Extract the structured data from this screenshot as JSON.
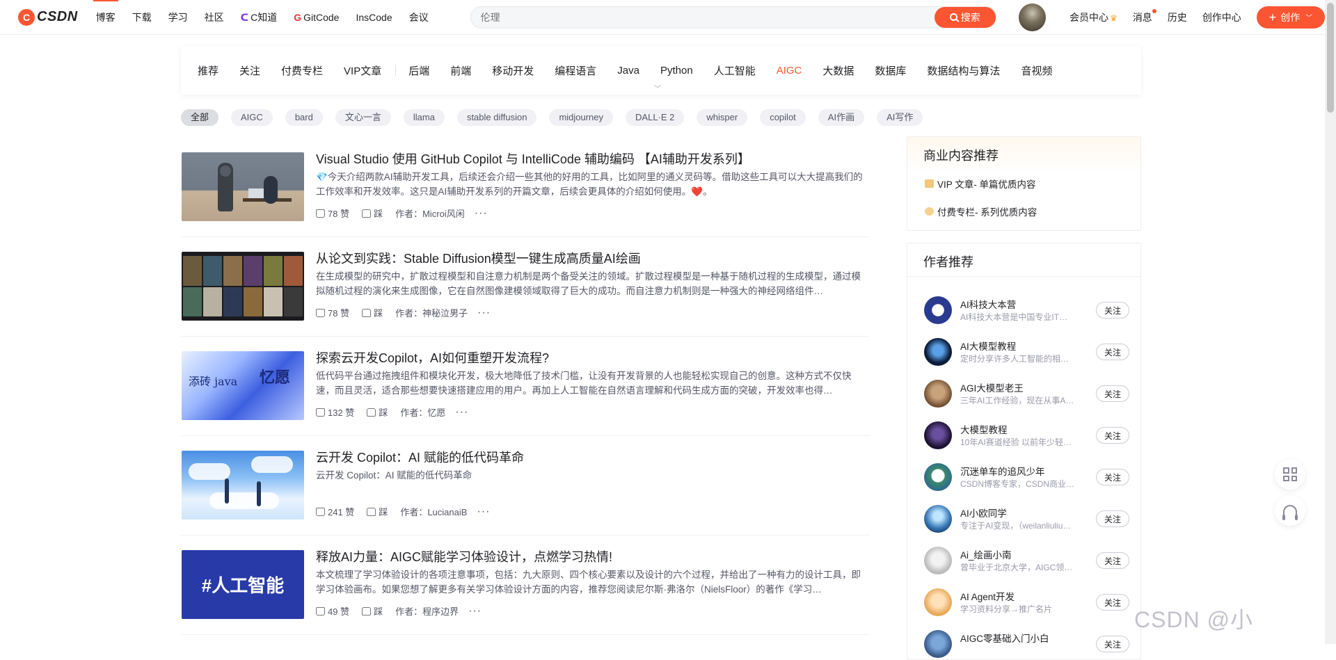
{
  "topnav": {
    "logo_text": "CSDN",
    "items": [
      "博客",
      "下载",
      "学习",
      "社区",
      "C知道",
      "GitCode",
      "InsCode",
      "会议"
    ],
    "active_index": 0,
    "search_placeholder": "伦理",
    "search_button": "搜索",
    "links": [
      "会员中心",
      "消息",
      "历史",
      "创作中心"
    ],
    "create_button": "创作"
  },
  "categories": [
    "推荐",
    "关注",
    "付费专栏",
    "VIP文章",
    "后端",
    "前端",
    "移动开发",
    "编程语言",
    "Java",
    "Python",
    "人工智能",
    "AIGC",
    "大数据",
    "数据库",
    "数据结构与算法",
    "音视频"
  ],
  "category_highlight": "AIGC",
  "tags": [
    "全部",
    "AIGC",
    "bard",
    "文心一言",
    "llama",
    "stable diffusion",
    "midjourney",
    "DALL·E 2",
    "whisper",
    "copilot",
    "AI作画",
    "AI写作"
  ],
  "articles": [
    {
      "title": "Visual Studio 使用 GitHub Copilot 与 IntelliCode 辅助编码 【AI辅助开发系列】",
      "desc": "💎今天介绍两款AI辅助开发工具，后续还会介绍一些其他的好用的工具，比如阿里的通义灵码等。借助这些工具可以大大提高我们的工作效率和开发效率。这只是AI辅助开发系列的开篇文章，后续会更具体的介绍如何使用。❤️。",
      "likes": "78 赞",
      "dislike": "踩",
      "author": "作者：Microi风闲"
    },
    {
      "title": "从论文到实践：Stable Diffusion模型一键生成高质量AI绘画",
      "desc": "在生成模型的研究中，扩散过程模型和自注意力机制是两个备受关注的领域。扩散过程模型是一种基于随机过程的生成模型，通过模拟随机过程的演化来生成图像，它在自然图像建模领域取得了巨大的成功。而自注意力机制则是一种强大的神经网络组件…",
      "likes": "78 赞",
      "dislike": "踩",
      "author": "作者：神秘泣男子"
    },
    {
      "title": "探索云开发Copilot，AI如何重塑开发流程?",
      "desc": "低代码平台通过拖拽组件和模块化开发，极大地降低了技术门槛，让没有开发背景的人也能轻松实现自己的创意。这种方式不仅快速，而且灵活，适合那些想要快速搭建应用的用户。再加上人工智能在自然语言理解和代码生成方面的突破，开发效率也得…",
      "likes": "132 赞",
      "dislike": "踩",
      "author": "作者：忆愿"
    },
    {
      "title": "云开发 Copilot：AI 赋能的低代码革命",
      "desc": "云开发 Copilot：AI 赋能的低代码革命",
      "likes": "241 赞",
      "dislike": "踩",
      "author": "作者：LucianaiB"
    },
    {
      "title": "释放AI力量：AIGC赋能学习体验设计，点燃学习热情!",
      "desc": "本文梳理了学习体验设计的各项注意事项，包括：九大原则、四个核心要素以及设计的六个过程，并给出了一种有力的设计工具，即学习体验画布。如果您想了解更多有关学习体验设计方面的内容，推荐您阅读尼尔斯·弗洛尔（NielsFloor）的著作《学习…",
      "likes": "49 赞",
      "dislike": "踩",
      "author": "作者：程序边界"
    }
  ],
  "thumb_texts": {
    "t3_left": "添砖 java",
    "t3_right": "忆愿",
    "t5": "#人工智能"
  },
  "sidebar": {
    "biz_title": "商业内容推荐",
    "biz_items": [
      "VIP 文章- 单篇优质内容",
      "付费专栏- 系列优质内容"
    ],
    "authors_title": "作者推荐",
    "follow_label": "关注",
    "authors": [
      {
        "name": "AI科技大本营",
        "desc": "AI科技大本营是中国专业IT社…"
      },
      {
        "name": "AI大模型教程",
        "desc": "定时分享许多人工智能的相关…"
      },
      {
        "name": "AGI大模型老王",
        "desc": "三年AI工作经验，现在从事A…"
      },
      {
        "name": "大模型教程",
        "desc": "10年AI赛道经验 以前年少轻…"
      },
      {
        "name": "沉迷单车的追风少年",
        "desc": "CSDN博客专家，CSDN商业…"
      },
      {
        "name": "AI小欧同学",
        "desc": "专注于AI变现，（weilanliuliu…"
      },
      {
        "name": "Ai_绘画小南",
        "desc": "曾毕业于北京大学，AIGC领…"
      },
      {
        "name": "AI Agent开发",
        "desc": "学习资料分享→推广名片"
      },
      {
        "name": "AIGC零基础入门小白",
        "desc": ""
      }
    ]
  },
  "watermark": "CSDN @小",
  "colors": {
    "accent": "#fc5531"
  }
}
